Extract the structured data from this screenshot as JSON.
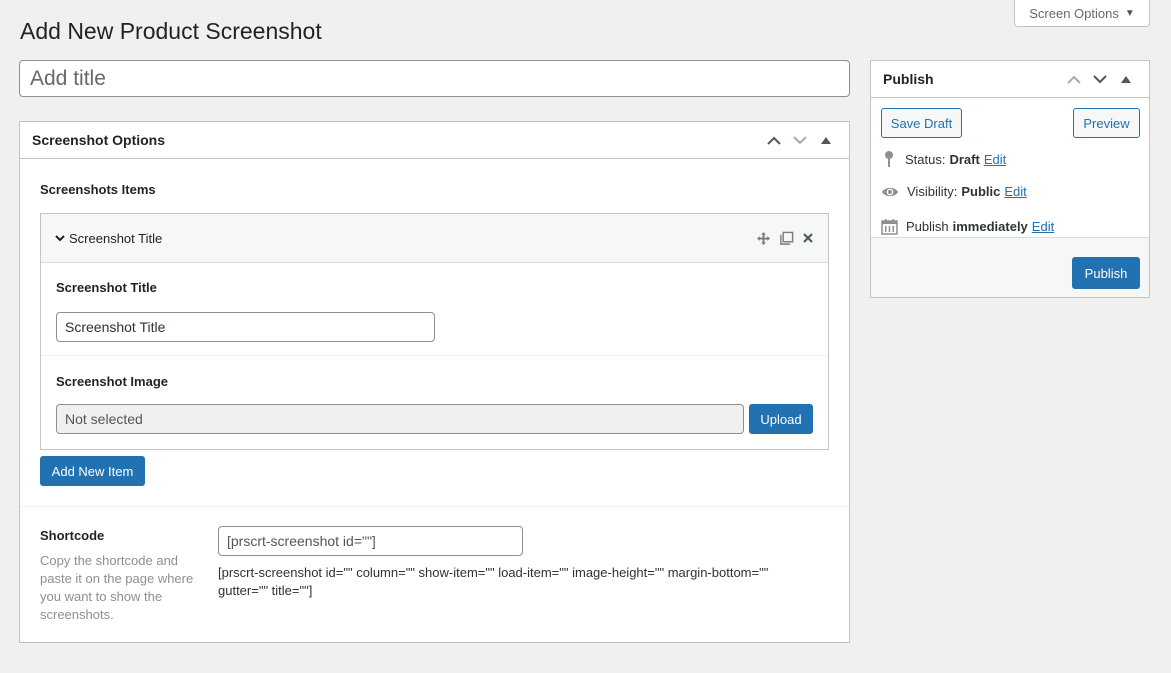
{
  "screen_options": {
    "label": "Screen Options",
    "caret": "▼"
  },
  "page": {
    "title": "Add New Product Screenshot"
  },
  "title_input": {
    "placeholder": "Add title",
    "value": ""
  },
  "screenshot_options": {
    "title": "Screenshot Options",
    "items_label": "Screenshots Items",
    "item": {
      "header_title": "Screenshot Title",
      "title_field_label": "Screenshot Title",
      "title_field_value": "Screenshot Title",
      "image_field_label": "Screenshot Image",
      "image_field_value": "Not selected",
      "upload_label": "Upload"
    },
    "add_item_label": "Add New Item",
    "shortcode": {
      "label": "Shortcode",
      "description": "Copy the shortcode and paste it on the page where you want to show the screenshots.",
      "short_value": "[prscrt-screenshot id=\"\"]",
      "full_text": "[prscrt-screenshot id=\"\" column=\"\" show-item=\"\" load-item=\"\" image-height=\"\" margin-bottom=\"\" gutter=\"\" title=\"\"]"
    }
  },
  "publish": {
    "title": "Publish",
    "save_draft_label": "Save Draft",
    "preview_label": "Preview",
    "status_label": "Status:",
    "status_value": "Draft",
    "visibility_label": "Visibility:",
    "visibility_value": "Public",
    "publish_label": "Publish",
    "publish_value": "immediately",
    "edit_label": "Edit",
    "publish_button_label": "Publish"
  },
  "colors": {
    "primary": "#2271b1",
    "background": "#f0f0f1",
    "border": "#c3c4c7"
  }
}
